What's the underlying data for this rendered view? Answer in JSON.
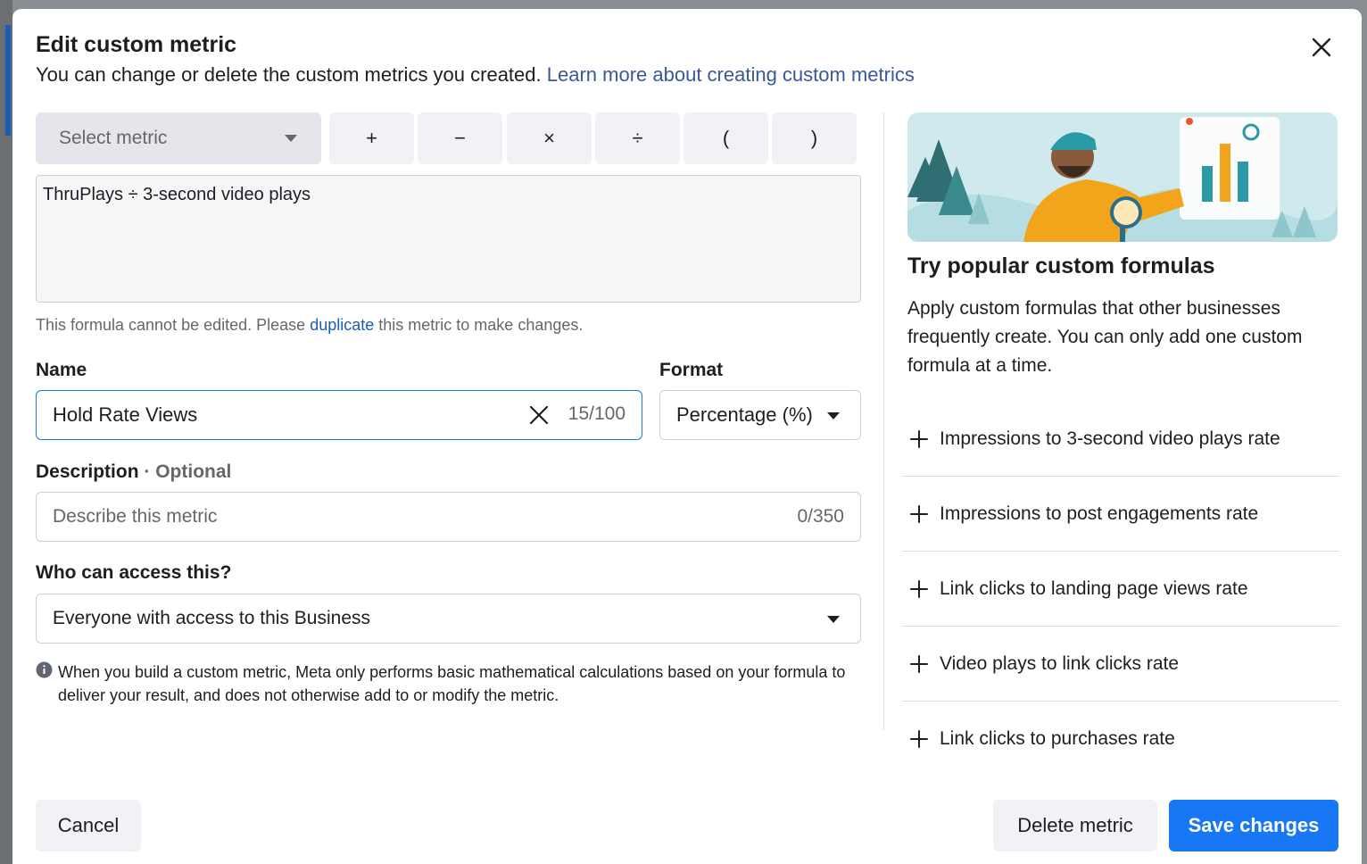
{
  "dialog": {
    "title": "Edit custom metric",
    "subtitle": "You can change or delete the custom metrics you created.",
    "learn_more_link": "Learn more about creating custom metrics"
  },
  "formula_builder": {
    "select_placeholder": "Select metric",
    "operators": [
      "+",
      "−",
      "×",
      "÷",
      "(",
      ")"
    ],
    "formula": "ThruPlays ÷ 3-second video plays",
    "note_before": "This formula cannot be edited. Please",
    "note_link": "duplicate",
    "note_after": "this metric to make changes."
  },
  "name_field": {
    "label": "Name",
    "value": "Hold Rate Views",
    "counter": "15/100"
  },
  "format_field": {
    "label": "Format",
    "value": "Percentage (%)"
  },
  "description_field": {
    "label": "Description",
    "optional": "· Optional",
    "placeholder": "Describe this metric",
    "counter": "0/350"
  },
  "access_field": {
    "label": "Who can access this?",
    "value": "Everyone with access to this Business"
  },
  "info_note": "When you build a custom metric, Meta only performs basic mathematical calculations based on your formula to deliver your result, and does not otherwise add to or modify the metric.",
  "popular": {
    "title": "Try popular custom formulas",
    "description": "Apply custom formulas that other businesses frequently create. You can only add one custom formula at a time.",
    "items": [
      "Impressions to 3-second video plays rate",
      "Impressions to post engagements rate",
      "Link clicks to landing page views rate",
      "Video plays to link clicks rate",
      "Link clicks to purchases rate"
    ]
  },
  "footer": {
    "cancel": "Cancel",
    "delete": "Delete metric",
    "save": "Save changes"
  },
  "colors": {
    "primary": "#1877f2",
    "link": "#385898",
    "muted_text": "#65676b"
  }
}
